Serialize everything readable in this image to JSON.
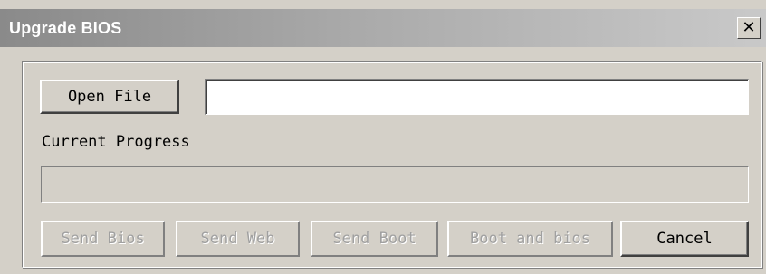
{
  "window": {
    "title": "Upgrade BIOS",
    "close_glyph": "✕"
  },
  "file": {
    "open_label": "Open File",
    "path_value": "",
    "path_placeholder": ""
  },
  "progress": {
    "label": "Current Progress",
    "value_percent": 0
  },
  "actions": {
    "send_bios": "Send Bios",
    "send_web": "Send Web",
    "send_boot": "Send Boot",
    "boot_and_bios": "Boot and bios",
    "cancel": "Cancel"
  },
  "icons": {
    "close": "close-icon"
  },
  "colors": {
    "titlebar_start": "#8a8a8a",
    "titlebar_end": "#c9c9c9",
    "face": "#d4d0c8",
    "disabled_text": "#a0a0a0"
  }
}
